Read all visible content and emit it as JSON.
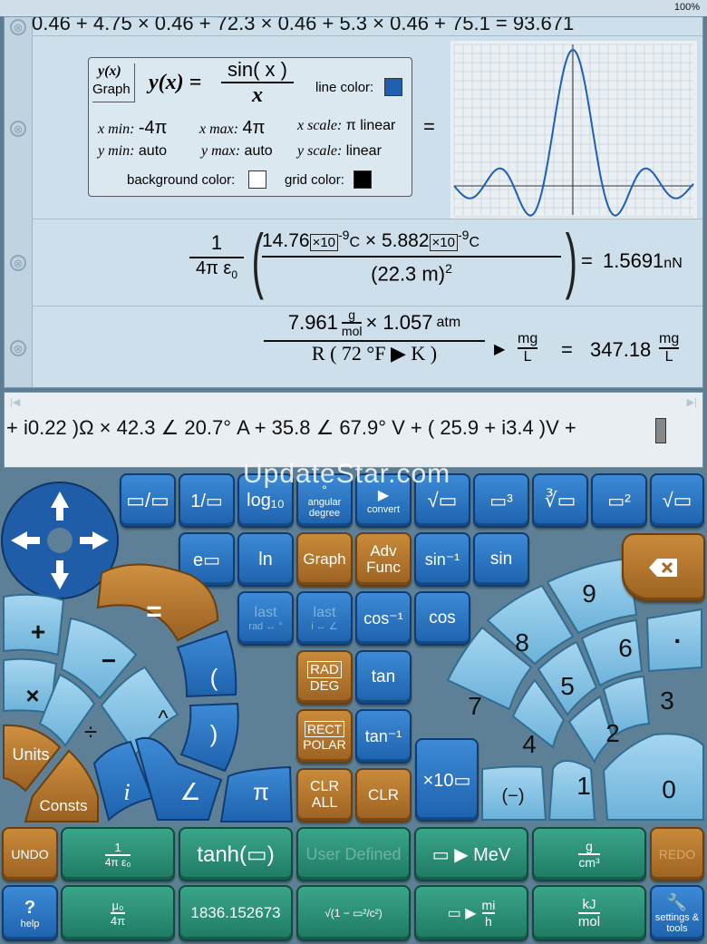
{
  "status": {
    "battery": "100%"
  },
  "history": {
    "line1": "0.46  + 4.75 × 0.46  + 72.3 × 0.46  + 5.3 × 0.46  + 75.1  =  93.671",
    "graph": {
      "label_top": "y(x)",
      "label_bottom": "Graph",
      "function_lhs": "y(x) =",
      "numerator": "sin( x )",
      "denominator": "x",
      "line_color_label": "line color:",
      "xmin_label": "x min:",
      "xmin_value": "-4π",
      "xmax_label": "x max:",
      "xmax_value": "4π",
      "xscale_label": "x scale:",
      "xscale_value": "π linear",
      "ymin_label": "y min:",
      "ymin_value": "auto",
      "ymax_label": "y max:",
      "ymax_value": "auto",
      "yscale_label": "y scale:",
      "yscale_value": "linear",
      "bg_color_label": "background color:",
      "grid_color_label": "grid color:",
      "equals": "=",
      "line_color": "#1f5fb0"
    },
    "coulomb": {
      "one": "1",
      "denom": "4π ε",
      "denom_sub": "0",
      "q1": "14.76",
      "times10": "×10",
      "exp": "-9",
      "unit_c": "C",
      "times": "×",
      "q2": "5.882",
      "r": "(22.3 m)",
      "r_exp": "2",
      "equals": "=",
      "result": "1.5691",
      "result_unit": "nN"
    },
    "gas": {
      "num_value": "7.961",
      "g": "g",
      "mol": "mol",
      "times_atm": "× 1.057",
      "atm": "atm",
      "denom": "R ( 72 °F ▶ K )",
      "arrow": "▶",
      "mg": "mg",
      "l": "L",
      "equals": "=",
      "result": "347.18",
      "result_mg": "mg",
      "result_l": "L"
    }
  },
  "entry": {
    "text": "+ i0.22 )Ω × 42.3 ∠ 20.7° A + 35.8 ∠ 67.9° V + ( 25.9 + i3.4 )V +"
  },
  "watermark": "UpdateStar.com",
  "keys": {
    "frac": "▭/▭",
    "inv": "1/▭",
    "log10": "log₁₀",
    "angular_deg": "angular degree",
    "angular_top": "°",
    "convert": "convert",
    "convert_top": "▶",
    "sqrt": "√▭",
    "cube": "▭³",
    "cbrt": "∛▭",
    "square": "▭²",
    "sqrt2": "√▭",
    "exp": "e▭",
    "ln": "ln",
    "graph": "Graph",
    "adv_func": "Adv Func",
    "asin": "sin⁻¹",
    "sin": "sin",
    "last_rad": "last",
    "last_rad_sub": "rad ↔ °",
    "last_i": "last",
    "last_i_sub": "i ↔ ∠",
    "acos": "cos⁻¹",
    "cos": "cos",
    "rad_deg_top": "RAD",
    "rad_deg_bottom": "DEG",
    "tan": "tan",
    "rect_top": "RECT",
    "rect_bottom": "POLAR",
    "atan": "tan⁻¹",
    "clr_all_top": "CLR",
    "clr_all_bottom": "ALL",
    "clr": "CLR",
    "x10": "×10▭",
    "plus": "+",
    "minus": "−",
    "equals": "=",
    "times": "×",
    "divide": "÷",
    "caret": "^",
    "lparen": "(",
    "rparen": ")",
    "units": "Units",
    "consts": "Consts",
    "i": "i",
    "angle": "∠",
    "pi": "π",
    "d9": "9",
    "d8": "8",
    "d6": "6",
    "dot": "·",
    "d7": "7",
    "d5": "5",
    "d3": "3",
    "d4": "4",
    "d2": "2",
    "d1": "1",
    "d0": "0",
    "neg": "(−)",
    "undo": "UNDO",
    "coulomb_k_num": "1",
    "coulomb_k_den": "4π ε₀",
    "tanh": "tanh(▭)",
    "user_defined": "User Defined",
    "to_mev": "▭ ▶ MeV",
    "g_cm3_num": "g",
    "g_cm3_den": "cm³",
    "redo": "REDO",
    "help_icon": "?",
    "help": "help",
    "mu0_num": "μ₀",
    "mu0_den": "4π",
    "ratio": "1836.152673",
    "lorentz": "√(1 − ▭²/c²)",
    "to_mih_num": "mi",
    "to_mih_den": "h",
    "kj_num": "kJ",
    "kj_den": "mol",
    "settings": "settings & tools"
  }
}
